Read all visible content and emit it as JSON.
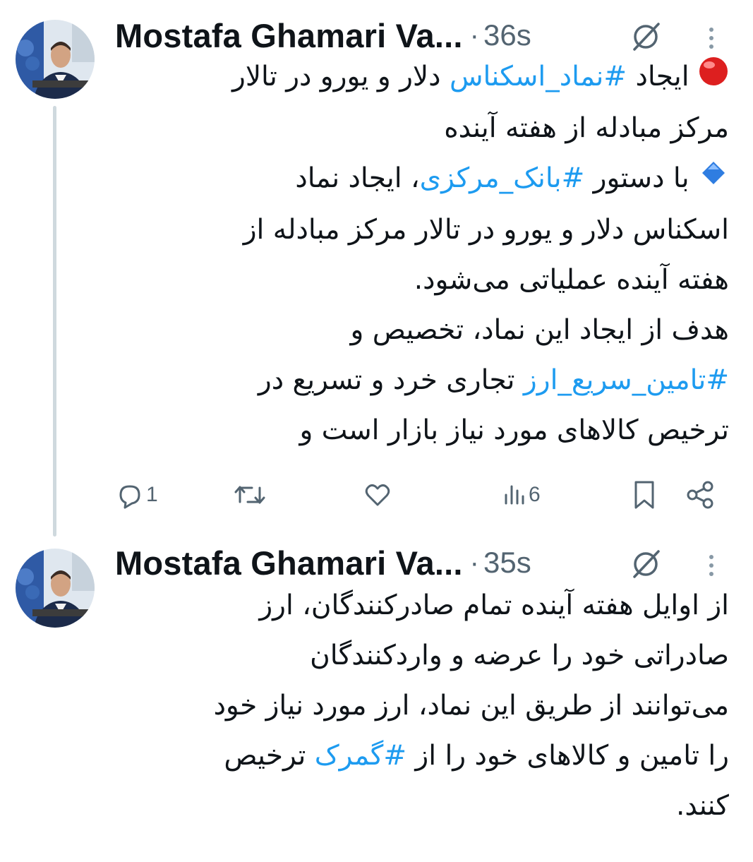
{
  "tweets": [
    {
      "author": "Mostafa Ghamari Va...",
      "separator": "·",
      "time": "36s",
      "avatar_icon": "profile-photo",
      "lines": [
        {
          "parts": [
            {
              "text": "red-circle",
              "type": "emoji"
            },
            {
              "text": " ایجاد ",
              "type": "text"
            },
            {
              "text": "#نماد_اسکناس",
              "type": "hashtag"
            },
            {
              "text": " دلار و یورو در تالار",
              "type": "text"
            }
          ]
        },
        {
          "parts": [
            {
              "text": "مرکز مبادله از هفته آینده",
              "type": "text"
            }
          ]
        },
        {
          "parts": [
            {
              "text": "blue-diamond",
              "type": "emoji"
            },
            {
              "text": " با دستور ",
              "type": "text"
            },
            {
              "text": "#بانک_مرکزی",
              "type": "hashtag"
            },
            {
              "text": "، ایجاد نماد",
              "type": "text"
            }
          ]
        },
        {
          "parts": [
            {
              "text": "اسکناس دلار و یورو در تالار مرکز مبادله از",
              "type": "text"
            }
          ]
        },
        {
          "parts": [
            {
              "text": "هفته آینده عملیاتی می‌شود.",
              "type": "text"
            }
          ]
        },
        {
          "parts": [
            {
              "text": "هدف از ایجاد این نماد، تخصیص و",
              "type": "text"
            }
          ]
        },
        {
          "parts": [
            {
              "text": "#تامین_سریع_ارز",
              "type": "hashtag"
            },
            {
              "text": " تجاری خرد و تسریع در",
              "type": "text"
            }
          ]
        },
        {
          "parts": [
            {
              "text": "ترخیص کالاهای مورد نیاز بازار است و",
              "type": "text"
            }
          ]
        }
      ],
      "actions": {
        "reply_count": "1",
        "retweet_count": "",
        "like_count": "",
        "views_count": "6"
      }
    },
    {
      "author": "Mostafa Ghamari Va...",
      "separator": "·",
      "time": "35s",
      "avatar_icon": "profile-photo",
      "lines": [
        {
          "parts": [
            {
              "text": "از اوایل هفته آینده تمام صادرکنندگان، ارز",
              "type": "text"
            }
          ]
        },
        {
          "parts": [
            {
              "text": "صادراتی خود را عرضه و واردکنندگان",
              "type": "text"
            }
          ]
        },
        {
          "parts": [
            {
              "text": "می‌توانند از طریق این نماد، ارز مورد نیاز خود",
              "type": "text"
            }
          ]
        },
        {
          "parts": [
            {
              "text": "را تامین و کالاهای خود را از ",
              "type": "text"
            },
            {
              "text": "#گمرک",
              "type": "hashtag"
            },
            {
              "text": " ترخیص",
              "type": "text"
            }
          ]
        },
        {
          "parts": [
            {
              "text": "کنند.",
              "type": "text"
            }
          ]
        }
      ]
    }
  ],
  "colors": {
    "text": "#0f1419",
    "muted": "#536471",
    "hashtag": "#1d9bf0",
    "thread_line": "#cfd9de"
  }
}
